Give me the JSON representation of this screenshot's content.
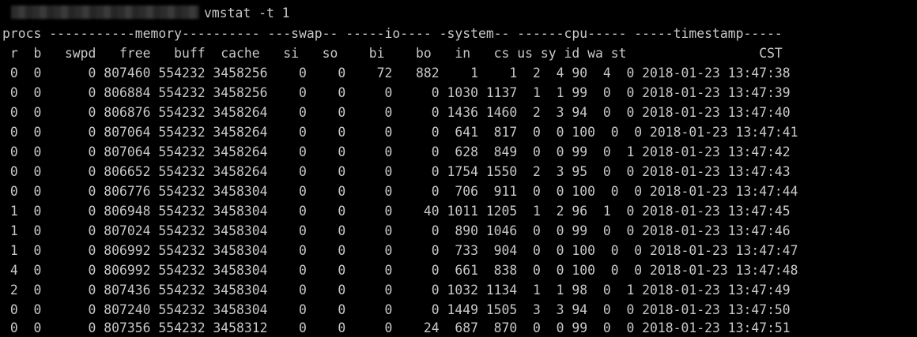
{
  "terminal": {
    "command": "vmstat -t 1",
    "header_groups": "procs -----------memory---------- ---swap-- -----io---- -system-- ------cpu----- -----timestamp-----",
    "header_columns": " r  b   swpd   free   buff  cache   si   so    bi    bo   in   cs us sy id wa st                 CST",
    "rows": [
      " 0  0      0 807460 554232 3458256    0    0    72   882    1    1  2  4 90  4  0 2018-01-23 13:47:38",
      " 0  0      0 806884 554232 3458256    0    0     0     0 1030 1137  1  1 99  0  0 2018-01-23 13:47:39",
      " 0  0      0 806876 554232 3458264    0    0     0     0 1436 1460  2  3 94  0  0 2018-01-23 13:47:40",
      " 0  0      0 807064 554232 3458264    0    0     0     0  641  817  0  0 100  0  0 2018-01-23 13:47:41",
      " 0  0      0 807064 554232 3458264    0    0     0     0  628  849  0  0 99  0  1 2018-01-23 13:47:42",
      " 0  0      0 806652 554232 3458264    0    0     0     0 1754 1550  2  3 95  0  0 2018-01-23 13:47:43",
      " 0  0      0 806776 554232 3458304    0    0     0     0  706  911  0  0 100  0  0 2018-01-23 13:47:44",
      " 1  0      0 806948 554232 3458304    0    0     0    40 1011 1205  1  2 96  1  0 2018-01-23 13:47:45",
      " 1  0      0 807024 554232 3458304    0    0     0     0  890 1046  0  0 99  0  0 2018-01-23 13:47:46",
      " 1  0      0 806992 554232 3458304    0    0     0     0  733  904  0  0 100  0  0 2018-01-23 13:47:47",
      " 4  0      0 806992 554232 3458304    0    0     0     0  661  838  0  0 100  0  0 2018-01-23 13:47:48",
      " 2  0      0 807436 554232 3458304    0    0     0     0 1032 1134  1  1 98  0  1 2018-01-23 13:47:49",
      " 0  0      0 807240 554232 3458304    0    0     0     0 1449 1505  3  3 94  0  0 2018-01-23 13:47:50",
      " 0  0      0 807356 554232 3458312    0    0     0    24  687  870  0  0 99  0  0 2018-01-23 13:47:51"
    ]
  },
  "colors": {
    "background": "#000000",
    "text": "#c8c8c8"
  }
}
